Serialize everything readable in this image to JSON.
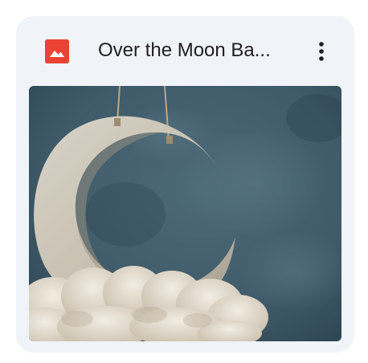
{
  "file": {
    "title": "Over the Moon Ba...",
    "type_icon": "image-file-icon",
    "menu_icon": "more-vert-icon"
  },
  "colors": {
    "card_background": "#f0f3f8",
    "file_icon": "#ea4335",
    "title_text": "#1f1f1f"
  }
}
